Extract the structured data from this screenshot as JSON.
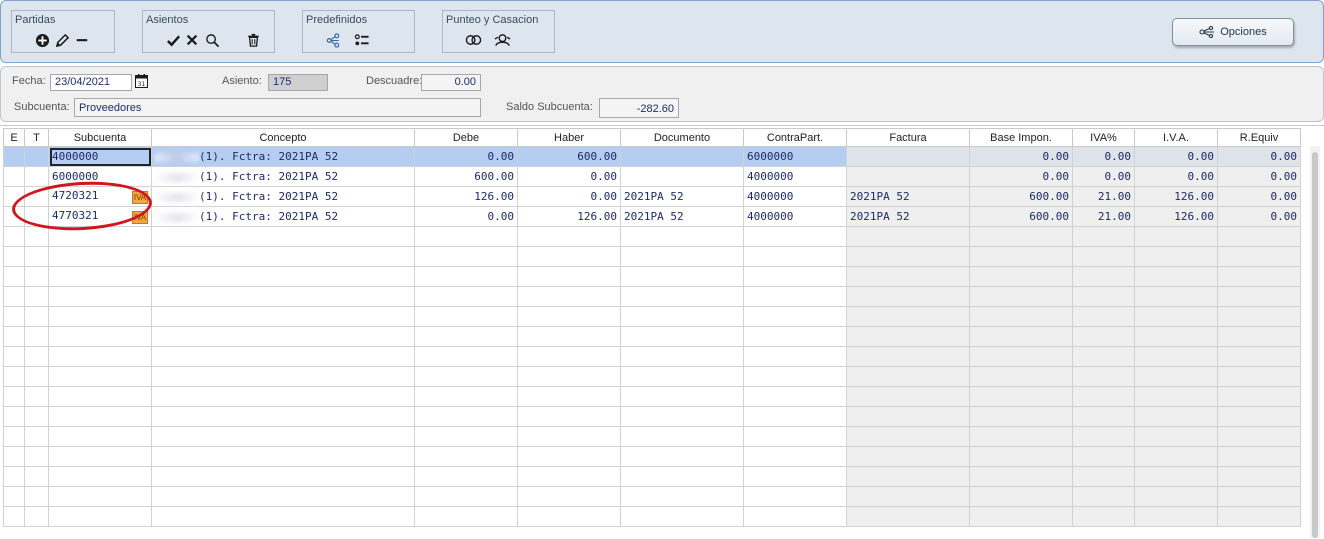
{
  "toolbar": {
    "groups": [
      {
        "title": "Partidas",
        "icons": [
          "add-circle-icon",
          "pencil-icon",
          "minus-icon"
        ]
      },
      {
        "title": "Asientos",
        "icons": [
          "check-icon",
          "x-icon",
          "search-icon",
          "trash-icon"
        ]
      },
      {
        "title": "Predefinidos",
        "icons": [
          "share-icon",
          "list-icon"
        ]
      },
      {
        "title": "Punteo y Casacion",
        "icons": [
          "rings-icon",
          "people-icon"
        ]
      }
    ],
    "opciones_label": "Opciones"
  },
  "form": {
    "fecha_label": "Fecha:",
    "fecha_value": "23/04/2021",
    "asiento_label": "Asiento:",
    "asiento_value": "175",
    "descuadre_label": "Descuadre:",
    "descuadre_value": "0.00",
    "subcuenta_label": "Subcuenta:",
    "subcuenta_value": "Proveedores",
    "saldo_label": "Saldo Subcuenta:",
    "saldo_value": "-282.60"
  },
  "grid": {
    "columns": [
      "E",
      "T",
      "Subcuenta",
      "Concepto",
      "Debe",
      "Haber",
      "Documento",
      "ContraPart.",
      "Factura",
      "Base Impon.",
      "IVA%",
      "I.V.A.",
      "R.Equiv"
    ],
    "rows": [
      {
        "subcuenta": "4000000",
        "concepto": "(1). Fctra: 2021PA 52",
        "debe": "0.00",
        "haber": "600.00",
        "documento": "",
        "contrapart": "6000000",
        "factura": "",
        "base": "0.00",
        "ivap": "0.00",
        "iva": "0.00",
        "requiv": "0.00",
        "badge": false,
        "selected": true
      },
      {
        "subcuenta": "6000000",
        "concepto": "(1). Fctra: 2021PA 52",
        "debe": "600.00",
        "haber": "0.00",
        "documento": "",
        "contrapart": "4000000",
        "factura": "",
        "base": "0.00",
        "ivap": "0.00",
        "iva": "0.00",
        "requiv": "0.00",
        "badge": false,
        "selected": false
      },
      {
        "subcuenta": "4720321",
        "concepto": "(1). Fctra: 2021PA 52",
        "debe": "126.00",
        "haber": "0.00",
        "documento": "2021PA 52",
        "contrapart": "4000000",
        "factura": "2021PA 52",
        "base": "600.00",
        "ivap": "21.00",
        "iva": "126.00",
        "requiv": "0.00",
        "badge": true,
        "selected": false
      },
      {
        "subcuenta": "4770321",
        "concepto": "(1). Fctra: 2021PA 52",
        "debe": "0.00",
        "haber": "126.00",
        "documento": "2021PA 52",
        "contrapart": "4000000",
        "factura": "2021PA 52",
        "base": "600.00",
        "ivap": "21.00",
        "iva": "126.00",
        "requiv": "0.00",
        "badge": true,
        "selected": false
      }
    ],
    "badge_text": "IVA"
  },
  "colors": {
    "toolbar_bg": "#dde6ee",
    "selected_row": "#b6cdf2",
    "annotation_red": "#d0161c"
  }
}
